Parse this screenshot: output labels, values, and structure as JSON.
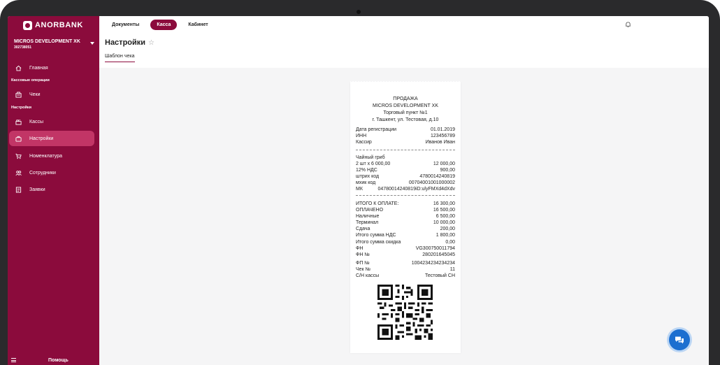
{
  "brand": {
    "name": "ANORBANK",
    "primary": "#8b0b3c",
    "active": "#c23566"
  },
  "company": {
    "name": "MICROS DEVELOPMENT XK",
    "id": "302738051"
  },
  "sidebar": {
    "items": [
      {
        "label": "Главная",
        "icon": "home-icon"
      },
      {
        "section": "Кассовые операции"
      },
      {
        "label": "Чеки",
        "icon": "receipt-icon"
      },
      {
        "section": "Настройки"
      },
      {
        "label": "Кассы",
        "icon": "cash-register-icon"
      },
      {
        "label": "Настройки",
        "icon": "settings-icon",
        "active": true
      },
      {
        "label": "Номенклатура",
        "icon": "cart-icon"
      },
      {
        "label": "Сотрудники",
        "icon": "users-icon"
      },
      {
        "label": "Заявки",
        "icon": "document-icon"
      }
    ],
    "help": "Помощь"
  },
  "topbar": {
    "tabs": [
      {
        "label": "Документы",
        "active": false
      },
      {
        "label": "Касса",
        "active": true
      },
      {
        "label": "Кабинет",
        "active": false
      }
    ]
  },
  "page": {
    "title": "Настройки",
    "subtab": "Шаблон чека"
  },
  "receipt": {
    "header": [
      "ПРОДАЖА",
      "MICROS DEVELOPMENT XK",
      "Торговый пункт №1",
      "г. Ташкент, ул. Тестовая, д.10"
    ],
    "info": [
      [
        "Дата регистрации",
        "01.01.2019"
      ],
      [
        "ИНН",
        "123456789"
      ],
      [
        "Кассир",
        "Иванов Иван"
      ]
    ],
    "item_name": "Чайный гриб",
    "item_rows": [
      [
        "2 шт х 6 000,00",
        "12 000,00"
      ],
      [
        "12% НДС",
        "900,00"
      ],
      [
        "штрих код",
        "4780014240819"
      ],
      [
        "мхик код",
        "00704001001000002"
      ],
      [
        "МК",
        "04780014240819iD:ulyFMXd4dXdv"
      ]
    ],
    "totals": [
      [
        "ИТОГО К ОПЛАТЕ:",
        "16 300,00"
      ],
      [
        "ОПЛАЧЕНО",
        "16 500,00"
      ],
      [
        "Наличные",
        "6 500,00"
      ],
      [
        "Терминал",
        "10 000,00"
      ],
      [
        "Сдача",
        "200,00"
      ],
      [
        "Итого сумма НДС",
        "1 800,00"
      ],
      [
        "Итого сумма скидка",
        "0,00"
      ],
      [
        "ФН",
        "VG300750011794"
      ],
      [
        "ФН №",
        "280201645045"
      ],
      [
        "ФП №",
        "1004234234234234"
      ],
      [
        "Чек №",
        "11"
      ],
      [
        "С/Н кассы",
        "Тестовый СН"
      ]
    ]
  }
}
